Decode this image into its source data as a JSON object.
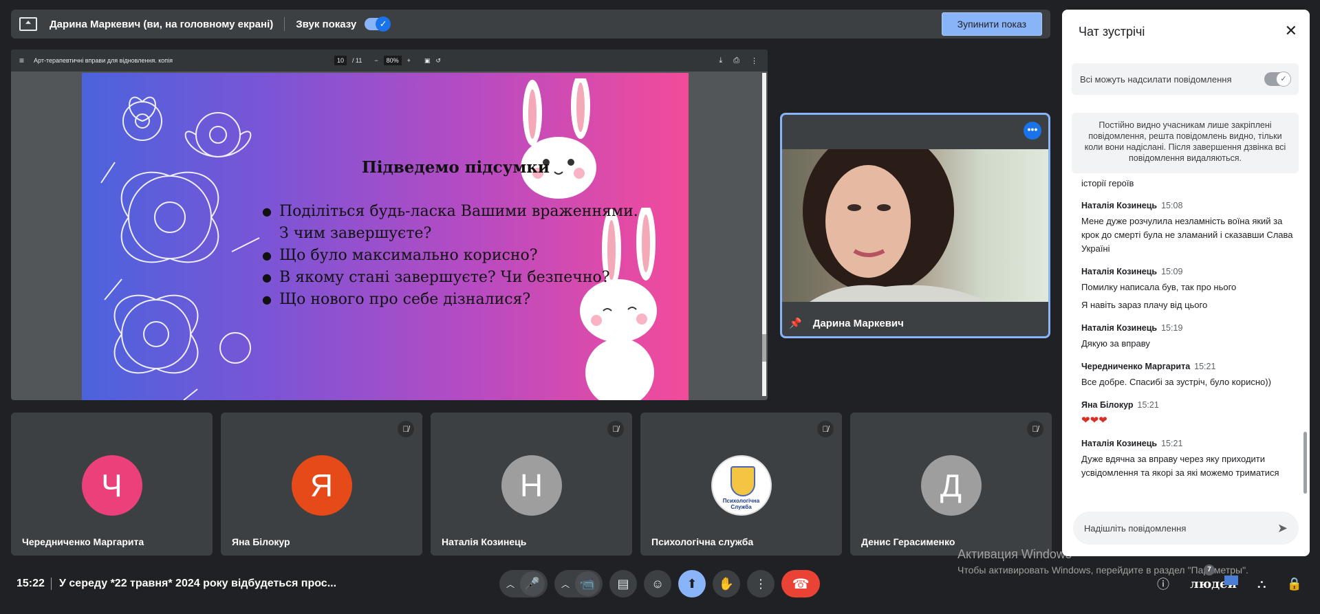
{
  "presenting_bar": {
    "title": "Дарина Маркевич (ви, на головному екрані)",
    "sound_label": "Звук показу",
    "stop_label": "Зупинити показ"
  },
  "pdf": {
    "doc_title": "Арт-терапевтичні вправи для відновлення. копія",
    "page_current": "10",
    "page_total": "/ 11",
    "zoom": "80%",
    "slide_title": "Підведемо підсумки",
    "bullets": [
      "Поділіться будь-ласка Вашими враженнями.",
      "З чим завершуєте?",
      "Що було максимально корисно?",
      "В якому стані завершуєте? Чи безпечно?",
      "Що нового про себе дізналися?"
    ]
  },
  "self_tile": {
    "name": "Дарина Маркевич"
  },
  "participants": [
    {
      "initial": "Ч",
      "name": "Чередниченко Маргарита",
      "color": "#ec407a"
    },
    {
      "initial": "Я",
      "name": "Яна Білокур",
      "color": "#e64a19"
    },
    {
      "initial": "Н",
      "name": "Наталія Козинець",
      "color": "#9e9e9e"
    },
    {
      "initial": "",
      "name": "Психологічна служба",
      "logo_text": "Психологічна Служба"
    },
    {
      "initial": "Д",
      "name": "Денис Герасименко",
      "color": "#9e9e9e"
    }
  ],
  "bottom": {
    "time": "15:22",
    "meeting_title": "У середу *22 травня* 2024 року відбудеться прос...",
    "people_label": "людей",
    "people_count": "7"
  },
  "windows_activation": {
    "title": "Активация Windows",
    "subtitle": "Чтобы активировать Windows, перейдите в раздел \"Параметры\"."
  },
  "chat": {
    "title": "Чат зустрічі",
    "permission_label": "Всі можуть надсилати повідомлення",
    "notice": "Постійно видно учасникам лише закріплені повідомлення, решта повідомлень видно, тільки коли вони надіслані. Після завершення дзвінка всі повідомлення видаляються.",
    "cut_text": "історії героїв",
    "messages": [
      {
        "sender": "Наталія Козинець",
        "time": "15:08",
        "lines": [
          "Мене дуже розчулила незламність воїна який за крок до смерті була не зламаний і сказавши Слава Україні"
        ]
      },
      {
        "sender": "Наталія Козинець",
        "time": "15:09",
        "lines": [
          "Помилку написала був, так про нього",
          "Я навіть зараз плачу від цього"
        ]
      },
      {
        "sender": "Наталія Козинець",
        "time": "15:19",
        "lines": [
          "Дякую за вправу"
        ]
      },
      {
        "sender": "Чередниченко Маргарита",
        "time": "15:21",
        "lines": [
          "Все добре. Спасибі за зустріч, було корисно))"
        ]
      },
      {
        "sender": "Яна Білокур",
        "time": "15:21",
        "lines": [
          "❤❤❤"
        ]
      },
      {
        "sender": "Наталія Козинець",
        "time": "15:21",
        "lines": [
          "Дуже вдячна за вправу через яку приходити усвідомлення та якорі за які можемо триматися"
        ]
      }
    ],
    "input_placeholder": "Надішліть повідомлення"
  }
}
